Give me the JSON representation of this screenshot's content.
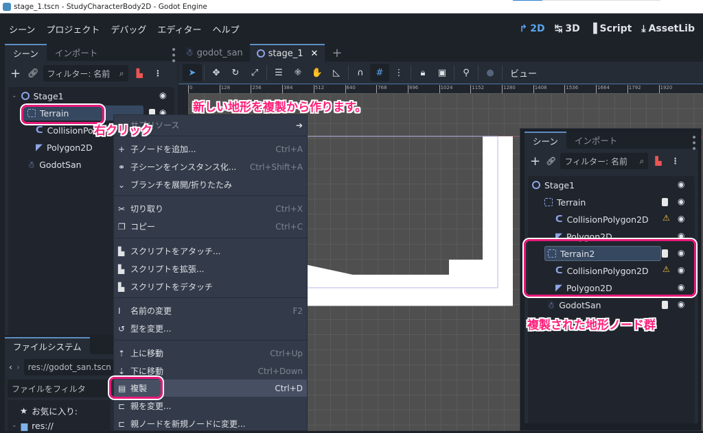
{
  "window": {
    "title": "stage_1.tscn - StudyCharacterBody2D - Godot Engine"
  },
  "menu": {
    "items": [
      "シーン",
      "プロジェクト",
      "デバッグ",
      "エディター",
      "ヘルプ"
    ]
  },
  "workspaces": [
    {
      "label": "2D",
      "active": true
    },
    {
      "label": "3D"
    },
    {
      "label": "Script"
    },
    {
      "label": "AssetLib"
    }
  ],
  "scene_dock": {
    "tabs": [
      "シーン",
      "インポート"
    ],
    "filter_placeholder": "フィルター: 名前",
    "tree": [
      {
        "name": "Stage1",
        "type": "Node2D",
        "depth": 0
      },
      {
        "name": "Terrain",
        "type": "StaticBody2D",
        "depth": 1,
        "selected": true
      },
      {
        "name": "CollisionPolygon2D",
        "type": "CollisionPolygon2D",
        "depth": 2,
        "display": "CollisionPol"
      },
      {
        "name": "Polygon2D",
        "type": "Polygon2D",
        "depth": 2
      },
      {
        "name": "GodotSan",
        "type": "CharacterBody2D",
        "depth": 1
      }
    ]
  },
  "filesystem_dock": {
    "tab": "ファイルシステム",
    "path": "res://godot_san.tscn",
    "filter_placeholder": "ファイルをフィルタ",
    "favorites": "お気に入り:",
    "root": "res://"
  },
  "editor_tabs": [
    {
      "label": "godot_san"
    },
    {
      "label": "stage_1",
      "active": true,
      "close": "✕"
    }
  ],
  "toolbar": {
    "view_label": "ビュー"
  },
  "ruler": [
    "0",
    "128",
    "256",
    "384",
    "512",
    "640",
    "768",
    "896",
    "1024",
    "1152",
    "1280",
    "1408",
    "1536",
    "1664",
    "1792",
    "1920"
  ],
  "context_menu": {
    "items": [
      {
        "label": "サブリソース",
        "shortcut": "",
        "icon": "arrow-right-icon"
      },
      {
        "label": "子ノードを追加...",
        "shortcut": "Ctrl+A",
        "icon": "plus-icon"
      },
      {
        "label": "子シーンをインスタンス化...",
        "shortcut": "Ctrl+Shift+A",
        "icon": "link-icon"
      },
      {
        "label": "ブランチを展開/折りたたみ",
        "shortcut": "",
        "icon": "chevron-down-icon"
      },
      {
        "label": "切り取り",
        "shortcut": "Ctrl+X",
        "icon": "scissors-icon"
      },
      {
        "label": "コピー",
        "shortcut": "Ctrl+C",
        "icon": "copy-icon"
      },
      {
        "label": "スクリプトをアタッチ...",
        "shortcut": "",
        "icon": "script-attach-icon"
      },
      {
        "label": "スクリプトを拡張...",
        "shortcut": "",
        "icon": "script-extend-icon"
      },
      {
        "label": "スクリプトをデタッチ",
        "shortcut": "",
        "icon": "script-detach-icon"
      },
      {
        "label": "名前の変更",
        "shortcut": "F2",
        "icon": "rename-icon"
      },
      {
        "label": "型を変更...",
        "shortcut": "",
        "icon": "change-type-icon"
      },
      {
        "label": "上に移動",
        "shortcut": "Ctrl+Up",
        "icon": "move-up-icon"
      },
      {
        "label": "下に移動",
        "shortcut": "Ctrl+Down",
        "icon": "move-down-icon"
      },
      {
        "label": "複製",
        "shortcut": "Ctrl+D",
        "icon": "duplicate-icon",
        "highlighted": true
      },
      {
        "label": "親を変更...",
        "shortcut": "",
        "icon": "reparent-icon"
      },
      {
        "label": "親ノードを新規ノードに変更...",
        "shortcut": "",
        "icon": "reparent-new-icon"
      }
    ]
  },
  "floating_scene_dock": {
    "tabs": [
      "シーン",
      "インポート"
    ],
    "filter_placeholder": "フィルター: 名前",
    "tree": [
      {
        "name": "Stage1"
      },
      {
        "name": "Terrain"
      },
      {
        "name": "CollisionPolygon2D",
        "warning": true
      },
      {
        "name": "Polygon2D"
      },
      {
        "name": "Terrain2",
        "selected": true
      },
      {
        "name": "CollisionPolygon2D",
        "warning": true
      },
      {
        "name": "Polygon2D"
      },
      {
        "name": "GodotSan"
      }
    ]
  },
  "annotations": {
    "right_click": "右クリック",
    "headline": "新しい地形を複製から作ります。",
    "duplicated": "複製された地形ノード群"
  },
  "colors": {
    "accent": "#5aa3e8",
    "annotation": "#e8197a"
  }
}
